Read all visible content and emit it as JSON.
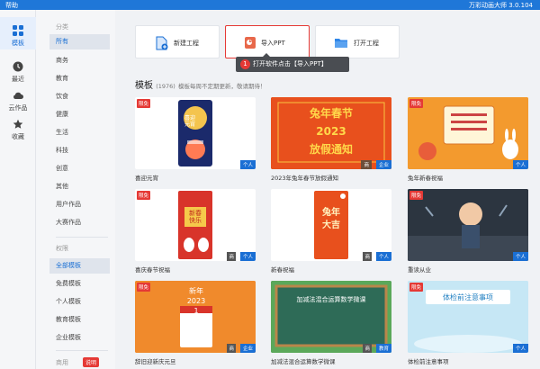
{
  "topbar": {
    "menu": "帮助",
    "title": "万彩动画大师 3.0.104"
  },
  "rail": [
    {
      "label": "模板",
      "icon": "grid-icon"
    },
    {
      "label": "最近",
      "icon": "clock-icon"
    },
    {
      "label": "云作品",
      "icon": "cloud-icon"
    },
    {
      "label": "收藏",
      "icon": "star-icon"
    }
  ],
  "categories": {
    "head1": "分类",
    "items1": [
      "所有",
      "商务",
      "教育",
      "饮食",
      "健康",
      "生活",
      "科技",
      "创意",
      "其他",
      "用户作品",
      "大赛作品"
    ],
    "head2": "权限",
    "items2": [
      "全部模板",
      "免费模板",
      "个人模板",
      "教育模板",
      "企业模板"
    ],
    "head3": "商用",
    "explain": "说明"
  },
  "toolbar": {
    "new": "新建工程",
    "import": "导入PPT",
    "open": "打开工程"
  },
  "tip": {
    "num": "1",
    "text": "打开软件点击【导入PPT】"
  },
  "section": {
    "title": "模板",
    "count": "(1976)",
    "note": "模板每周不定期更新，敬请期待！"
  },
  "cards": [
    {
      "caption": "喜迎元宵",
      "free": "限免",
      "tags": [
        "个人"
      ],
      "art": "喜迎\n元宵"
    },
    {
      "caption": "2023年兔年春节放假通知",
      "free": "",
      "tags": [
        "商",
        "企业"
      ],
      "art": "兔年春节\n2023\n放假通知"
    },
    {
      "caption": "兔年新春祝福",
      "free": "限免",
      "tags": [
        "个人"
      ],
      "art": ""
    },
    {
      "caption": "喜庆春节祝福",
      "free": "限免",
      "tags": [
        "商",
        "个人"
      ],
      "art": "新春\n快乐"
    },
    {
      "caption": "新春祝福",
      "free": "",
      "tags": [
        "商",
        "个人"
      ],
      "art": "兔年\n大吉"
    },
    {
      "caption": "重读从业",
      "free": "限免",
      "tags": [
        "个人"
      ],
      "art": ""
    },
    {
      "caption": "辞旧迎新庆元旦",
      "free": "限免",
      "tags": [
        "商",
        "企业"
      ],
      "art": "新年\n2023\n1\nJanuary"
    },
    {
      "caption": "加减法混合运算数学微课",
      "free": "",
      "tags": [
        "商",
        "教育"
      ],
      "art": "加减法混合运算数学微课"
    },
    {
      "caption": "体检前注意事项",
      "free": "限免",
      "tags": [
        "个人"
      ],
      "art": "体检前注意事项"
    }
  ],
  "colors": {
    "accent": "#1a6fd4",
    "red": "#e53935",
    "topbar": "#1f77d8"
  }
}
